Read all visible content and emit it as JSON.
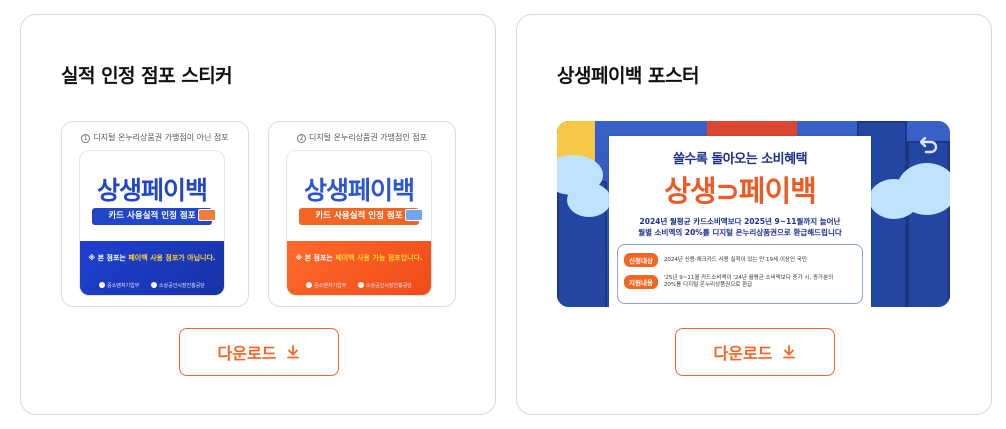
{
  "left_card": {
    "title": "실적 인정 점포 스티커",
    "download_label": "다운로드",
    "stickers": [
      {
        "number": "1",
        "caption": "디지털 온누리상품권 가맹점이 아닌 점포",
        "brand": "상생페이백",
        "pill": "카드 사용실적 인정 점포",
        "notice_prefix": "※ 본 점포는 ",
        "notice_highlight": "페이백 사용 점포가 아닙니다.",
        "logo_1": "중소벤처기업부",
        "logo_2": "소상공인시장진흥공단",
        "accent": "#2146c7"
      },
      {
        "number": "2",
        "caption": "디지털 온누리상품권 가맹점인 점포",
        "brand": "상생페이백",
        "pill": "카드 사용실적 인정 점포",
        "notice_prefix": "※ 본 점포는 ",
        "notice_highlight": "페이백 사용 가능 점포입니다.",
        "logo_1": "중소벤처기업부",
        "logo_2": "소상공인시장진흥공단",
        "accent": "#f26522"
      }
    ]
  },
  "right_card": {
    "title": "상생페이백 포스터",
    "download_label": "다운로드",
    "poster": {
      "headline": "쓸수록 돌아오는 소비혜택",
      "brand": "상생⊃페이백",
      "desc_line1": "2024년 월평균 카드소비액보다 2025년 9~11월까지 늘어난",
      "desc_line2": "월별 소비액의 20%를 디지털 온누리상품권으로 환급해드립니다",
      "row1_tag": "신청대상",
      "row1_text": "2024년 신용·체크카드 사용 실적이 있는 만 19세 이상인 국민",
      "row2_tag": "지원내용",
      "row2_text": "'25년 9~11월 카드소비액이 '24년 월평균 소비액보다 증가 시, 증가분의 20%를 디지털 온누리상품권으로 환급"
    }
  },
  "colors": {
    "accent_orange": "#f26522",
    "brand_blue": "#2146c7",
    "card_border": "#d9d9d9"
  },
  "icons": {
    "download": "download-arrow-icon",
    "back": "return-arrow-icon"
  }
}
